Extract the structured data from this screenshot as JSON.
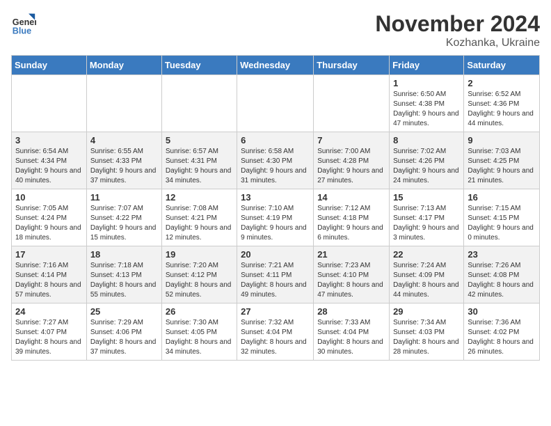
{
  "header": {
    "title": "November 2024",
    "subtitle": "Kozhanka, Ukraine",
    "logo_line1": "General",
    "logo_line2": "Blue"
  },
  "weekdays": [
    "Sunday",
    "Monday",
    "Tuesday",
    "Wednesday",
    "Thursday",
    "Friday",
    "Saturday"
  ],
  "weeks": [
    [
      {
        "day": "",
        "sunrise": "",
        "sunset": "",
        "daylight": ""
      },
      {
        "day": "",
        "sunrise": "",
        "sunset": "",
        "daylight": ""
      },
      {
        "day": "",
        "sunrise": "",
        "sunset": "",
        "daylight": ""
      },
      {
        "day": "",
        "sunrise": "",
        "sunset": "",
        "daylight": ""
      },
      {
        "day": "",
        "sunrise": "",
        "sunset": "",
        "daylight": ""
      },
      {
        "day": "1",
        "sunrise": "Sunrise: 6:50 AM",
        "sunset": "Sunset: 4:38 PM",
        "daylight": "Daylight: 9 hours and 47 minutes."
      },
      {
        "day": "2",
        "sunrise": "Sunrise: 6:52 AM",
        "sunset": "Sunset: 4:36 PM",
        "daylight": "Daylight: 9 hours and 44 minutes."
      }
    ],
    [
      {
        "day": "3",
        "sunrise": "Sunrise: 6:54 AM",
        "sunset": "Sunset: 4:34 PM",
        "daylight": "Daylight: 9 hours and 40 minutes."
      },
      {
        "day": "4",
        "sunrise": "Sunrise: 6:55 AM",
        "sunset": "Sunset: 4:33 PM",
        "daylight": "Daylight: 9 hours and 37 minutes."
      },
      {
        "day": "5",
        "sunrise": "Sunrise: 6:57 AM",
        "sunset": "Sunset: 4:31 PM",
        "daylight": "Daylight: 9 hours and 34 minutes."
      },
      {
        "day": "6",
        "sunrise": "Sunrise: 6:58 AM",
        "sunset": "Sunset: 4:30 PM",
        "daylight": "Daylight: 9 hours and 31 minutes."
      },
      {
        "day": "7",
        "sunrise": "Sunrise: 7:00 AM",
        "sunset": "Sunset: 4:28 PM",
        "daylight": "Daylight: 9 hours and 27 minutes."
      },
      {
        "day": "8",
        "sunrise": "Sunrise: 7:02 AM",
        "sunset": "Sunset: 4:26 PM",
        "daylight": "Daylight: 9 hours and 24 minutes."
      },
      {
        "day": "9",
        "sunrise": "Sunrise: 7:03 AM",
        "sunset": "Sunset: 4:25 PM",
        "daylight": "Daylight: 9 hours and 21 minutes."
      }
    ],
    [
      {
        "day": "10",
        "sunrise": "Sunrise: 7:05 AM",
        "sunset": "Sunset: 4:24 PM",
        "daylight": "Daylight: 9 hours and 18 minutes."
      },
      {
        "day": "11",
        "sunrise": "Sunrise: 7:07 AM",
        "sunset": "Sunset: 4:22 PM",
        "daylight": "Daylight: 9 hours and 15 minutes."
      },
      {
        "day": "12",
        "sunrise": "Sunrise: 7:08 AM",
        "sunset": "Sunset: 4:21 PM",
        "daylight": "Daylight: 9 hours and 12 minutes."
      },
      {
        "day": "13",
        "sunrise": "Sunrise: 7:10 AM",
        "sunset": "Sunset: 4:19 PM",
        "daylight": "Daylight: 9 hours and 9 minutes."
      },
      {
        "day": "14",
        "sunrise": "Sunrise: 7:12 AM",
        "sunset": "Sunset: 4:18 PM",
        "daylight": "Daylight: 9 hours and 6 minutes."
      },
      {
        "day": "15",
        "sunrise": "Sunrise: 7:13 AM",
        "sunset": "Sunset: 4:17 PM",
        "daylight": "Daylight: 9 hours and 3 minutes."
      },
      {
        "day": "16",
        "sunrise": "Sunrise: 7:15 AM",
        "sunset": "Sunset: 4:15 PM",
        "daylight": "Daylight: 9 hours and 0 minutes."
      }
    ],
    [
      {
        "day": "17",
        "sunrise": "Sunrise: 7:16 AM",
        "sunset": "Sunset: 4:14 PM",
        "daylight": "Daylight: 8 hours and 57 minutes."
      },
      {
        "day": "18",
        "sunrise": "Sunrise: 7:18 AM",
        "sunset": "Sunset: 4:13 PM",
        "daylight": "Daylight: 8 hours and 55 minutes."
      },
      {
        "day": "19",
        "sunrise": "Sunrise: 7:20 AM",
        "sunset": "Sunset: 4:12 PM",
        "daylight": "Daylight: 8 hours and 52 minutes."
      },
      {
        "day": "20",
        "sunrise": "Sunrise: 7:21 AM",
        "sunset": "Sunset: 4:11 PM",
        "daylight": "Daylight: 8 hours and 49 minutes."
      },
      {
        "day": "21",
        "sunrise": "Sunrise: 7:23 AM",
        "sunset": "Sunset: 4:10 PM",
        "daylight": "Daylight: 8 hours and 47 minutes."
      },
      {
        "day": "22",
        "sunrise": "Sunrise: 7:24 AM",
        "sunset": "Sunset: 4:09 PM",
        "daylight": "Daylight: 8 hours and 44 minutes."
      },
      {
        "day": "23",
        "sunrise": "Sunrise: 7:26 AM",
        "sunset": "Sunset: 4:08 PM",
        "daylight": "Daylight: 8 hours and 42 minutes."
      }
    ],
    [
      {
        "day": "24",
        "sunrise": "Sunrise: 7:27 AM",
        "sunset": "Sunset: 4:07 PM",
        "daylight": "Daylight: 8 hours and 39 minutes."
      },
      {
        "day": "25",
        "sunrise": "Sunrise: 7:29 AM",
        "sunset": "Sunset: 4:06 PM",
        "daylight": "Daylight: 8 hours and 37 minutes."
      },
      {
        "day": "26",
        "sunrise": "Sunrise: 7:30 AM",
        "sunset": "Sunset: 4:05 PM",
        "daylight": "Daylight: 8 hours and 34 minutes."
      },
      {
        "day": "27",
        "sunrise": "Sunrise: 7:32 AM",
        "sunset": "Sunset: 4:04 PM",
        "daylight": "Daylight: 8 hours and 32 minutes."
      },
      {
        "day": "28",
        "sunrise": "Sunrise: 7:33 AM",
        "sunset": "Sunset: 4:04 PM",
        "daylight": "Daylight: 8 hours and 30 minutes."
      },
      {
        "day": "29",
        "sunrise": "Sunrise: 7:34 AM",
        "sunset": "Sunset: 4:03 PM",
        "daylight": "Daylight: 8 hours and 28 minutes."
      },
      {
        "day": "30",
        "sunrise": "Sunrise: 7:36 AM",
        "sunset": "Sunset: 4:02 PM",
        "daylight": "Daylight: 8 hours and 26 minutes."
      }
    ]
  ]
}
